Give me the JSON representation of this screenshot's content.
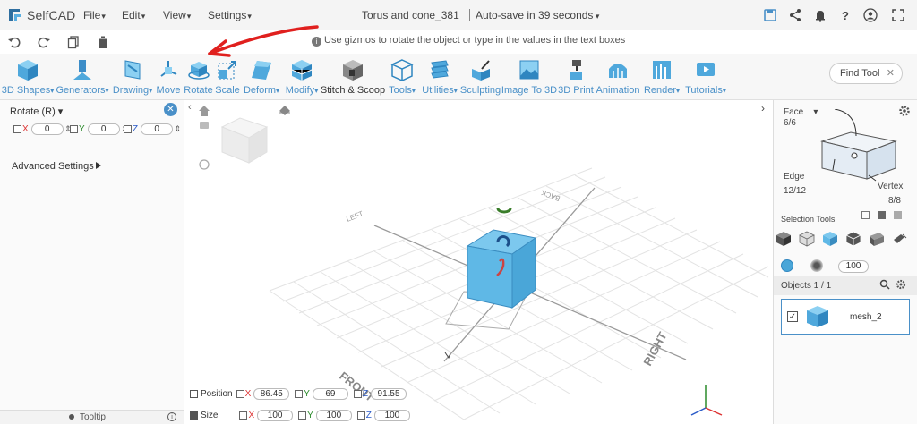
{
  "app": {
    "name": "SelfCAD",
    "title": "Torus and cone_381",
    "autosave": "Auto-save in 39 seconds"
  },
  "menus": [
    "File",
    "Edit",
    "View",
    "Settings"
  ],
  "hint": "Use gizmos to rotate the object or type in the values in the text boxes",
  "tools": [
    {
      "label": "3D Shapes",
      "icon": "cube-icon"
    },
    {
      "label": "Generators",
      "icon": "generator-icon"
    },
    {
      "label": "Drawing",
      "icon": "drawing-icon"
    },
    {
      "label": "Move",
      "icon": "move-icon"
    },
    {
      "label": "Rotate",
      "icon": "rotate-icon"
    },
    {
      "label": "Scale",
      "icon": "scale-icon"
    },
    {
      "label": "Deform",
      "icon": "deform-icon"
    },
    {
      "label": "Modify",
      "icon": "modify-icon"
    },
    {
      "label": "Stitch & Scoop",
      "icon": "stitch-scoop-icon"
    },
    {
      "label": "Tools",
      "icon": "tools-icon"
    },
    {
      "label": "Utilities",
      "icon": "utilities-icon"
    },
    {
      "label": "Sculpting",
      "icon": "sculpting-icon"
    },
    {
      "label": "Image To 3D",
      "icon": "image-to-3d-icon"
    },
    {
      "label": "3D Print",
      "icon": "3d-print-icon"
    },
    {
      "label": "Animation",
      "icon": "animation-icon"
    },
    {
      "label": "Render",
      "icon": "render-icon"
    },
    {
      "label": "Tutorials",
      "icon": "tutorials-icon"
    }
  ],
  "find_tool": {
    "placeholder": "Find Tool"
  },
  "left_panel": {
    "title": "Rotate (R)",
    "x_label": "X",
    "x_value": "0",
    "y_label": "Y",
    "y_value": "0",
    "z_label": "Z",
    "z_value": "0",
    "advanced": "Advanced Settings",
    "tooltip": "Tooltip"
  },
  "viewport": {
    "labels": {
      "left": "LEFT",
      "back": "BACK",
      "front": "FRONT",
      "right": "RIGHT"
    }
  },
  "right_panel": {
    "mode": "Face",
    "face_count": "6/6",
    "edge_label": "Edge",
    "edge_count": "12/12",
    "vertex_label": "Vertex",
    "vertex_count": "8/8",
    "selection_tools": "Selection Tools",
    "brush_size": "100",
    "objects_label": "Objects 1 / 1",
    "object_name": "mesh_2"
  },
  "bottom": {
    "position_label": "Position",
    "px": "86.45",
    "py": "69",
    "pz": "91.55",
    "size_label": "Size",
    "sx": "100",
    "sy": "100",
    "sz": "100",
    "x": "X",
    "y": "Y",
    "z": "Z"
  },
  "colors": {
    "accent": "#4a90c8",
    "cube": "#5fb8e6",
    "annotation": "#e0201e"
  }
}
